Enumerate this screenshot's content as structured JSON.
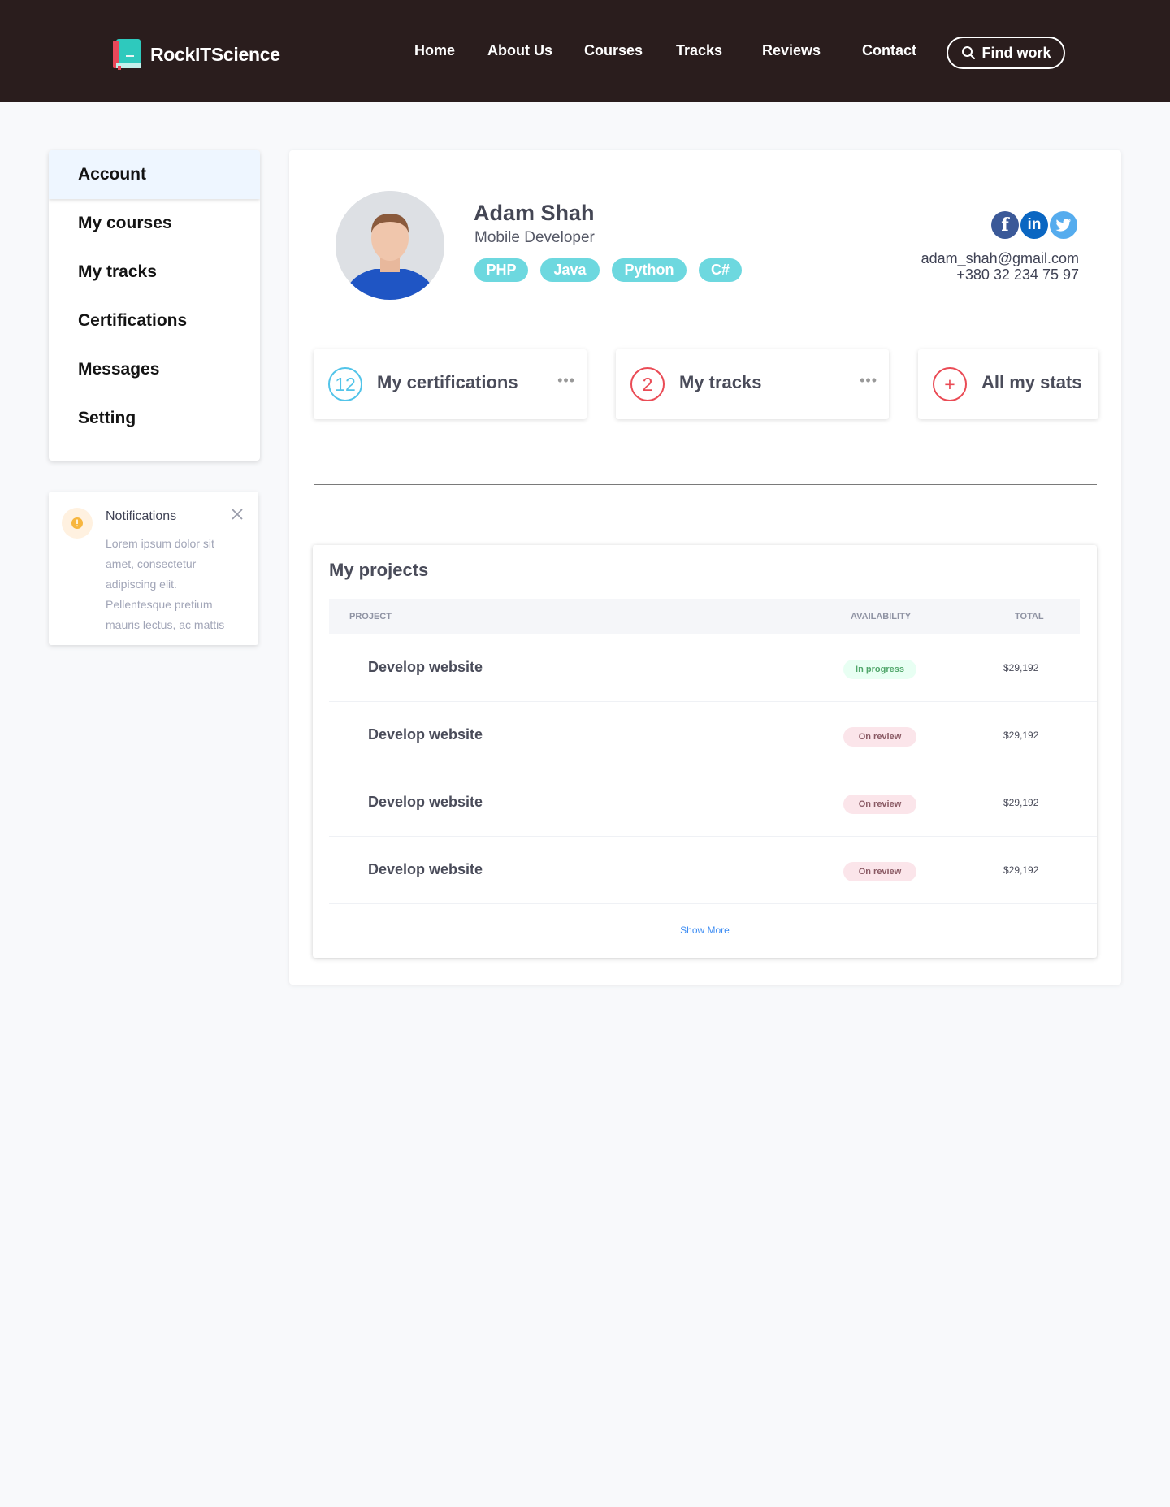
{
  "header": {
    "brand": "RockITScience",
    "nav": [
      "Home",
      "About Us",
      "Courses",
      "Tracks",
      "Reviews",
      "Contact"
    ],
    "find_work_label": "Find work"
  },
  "sidebar": {
    "items": [
      "Account",
      "My courses",
      "My tracks",
      "Certifications",
      "Messages",
      "Setting"
    ],
    "active": "Account"
  },
  "notification": {
    "title": "Notifications",
    "body": "Lorem ipsum dolor sit amet, consectetur adipiscing elit. Pellentesque pretium mauris lectus, ac mattis"
  },
  "profile": {
    "name": "Adam Shah",
    "role": "Mobile Developer",
    "tags": [
      "PHP",
      "Java",
      "Python",
      "C#"
    ],
    "email": "adam_shah@gmail.com",
    "phone": "+380 32 234 75 97",
    "socials": [
      "facebook-icon",
      "linkedin-icon",
      "twitter-icon"
    ]
  },
  "stats": [
    {
      "value": "12",
      "label": "My certifications",
      "color": "#52c4e9"
    },
    {
      "value": "2",
      "label": "My tracks",
      "color": "#ea4b55"
    },
    {
      "value": "+",
      "label": "All my stats",
      "color": "#ea4b55"
    }
  ],
  "projects": {
    "title": "My projects",
    "columns": [
      "PROJECT",
      "AVAILABILITY",
      "TOTAL"
    ],
    "rows": [
      {
        "name": "Develop website",
        "status": "In progress",
        "total": "$29,192"
      },
      {
        "name": "Develop website",
        "status": "On review",
        "total": "$29,192"
      },
      {
        "name": "Develop website",
        "status": "On review",
        "total": "$29,192"
      },
      {
        "name": "Develop website",
        "status": "On review",
        "total": "$29,192"
      }
    ],
    "show_more": "Show More"
  }
}
